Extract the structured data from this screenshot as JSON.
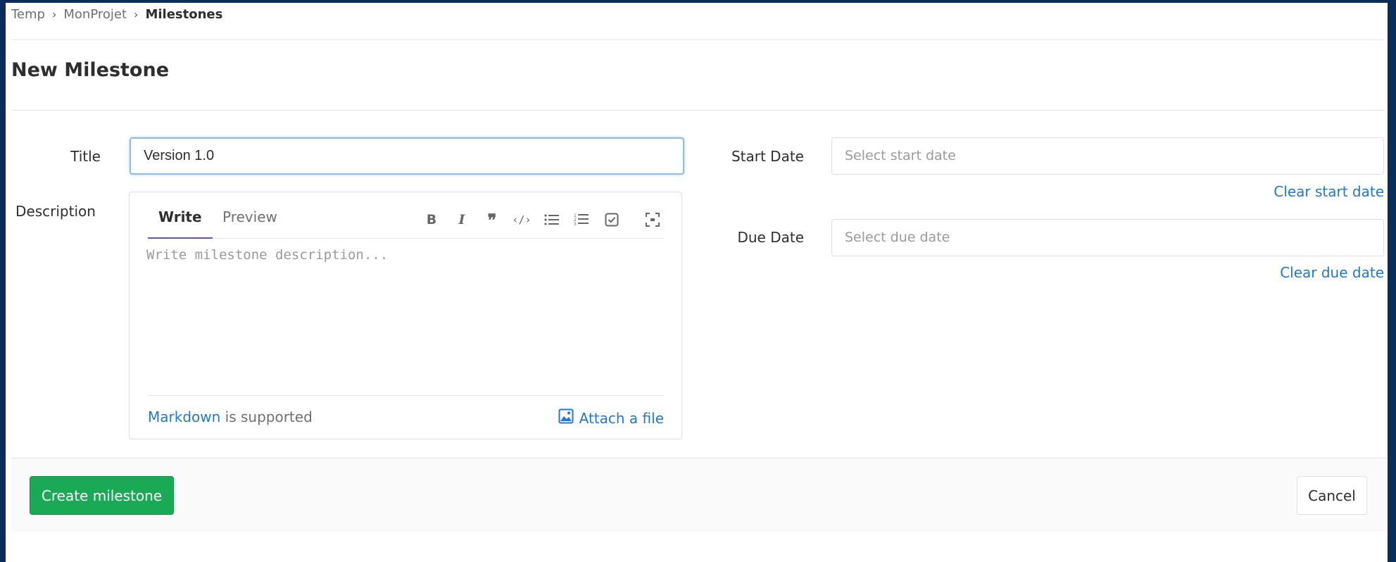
{
  "breadcrumb": {
    "items": [
      "Temp",
      "MonProjet"
    ],
    "current": "Milestones",
    "separator": "›"
  },
  "page": {
    "title": "New Milestone"
  },
  "form": {
    "title_label": "Title",
    "title_value": "Version 1.0",
    "description_label": "Description",
    "tabs": {
      "write": "Write",
      "preview": "Preview"
    },
    "description_placeholder": "Write milestone description...",
    "markdown_link": "Markdown",
    "markdown_suffix": " is supported",
    "attach_label": "Attach a file",
    "start_date_label": "Start Date",
    "start_date_placeholder": "Select start date",
    "clear_start": "Clear start date",
    "due_date_label": "Due Date",
    "due_date_placeholder": "Select due date",
    "clear_due": "Clear due date"
  },
  "toolbar": {
    "icons": [
      "bold-icon",
      "italic-icon",
      "quote-icon",
      "code-icon",
      "bullet-list-icon",
      "numbered-list-icon",
      "task-list-icon",
      "fullscreen-icon"
    ]
  },
  "actions": {
    "create": "Create milestone",
    "cancel": "Cancel"
  },
  "colors": {
    "frame": "#0b2d5c",
    "primary_button": "#1aaa55",
    "link": "#1f78d1",
    "active_tab": "#6b4fbb"
  }
}
